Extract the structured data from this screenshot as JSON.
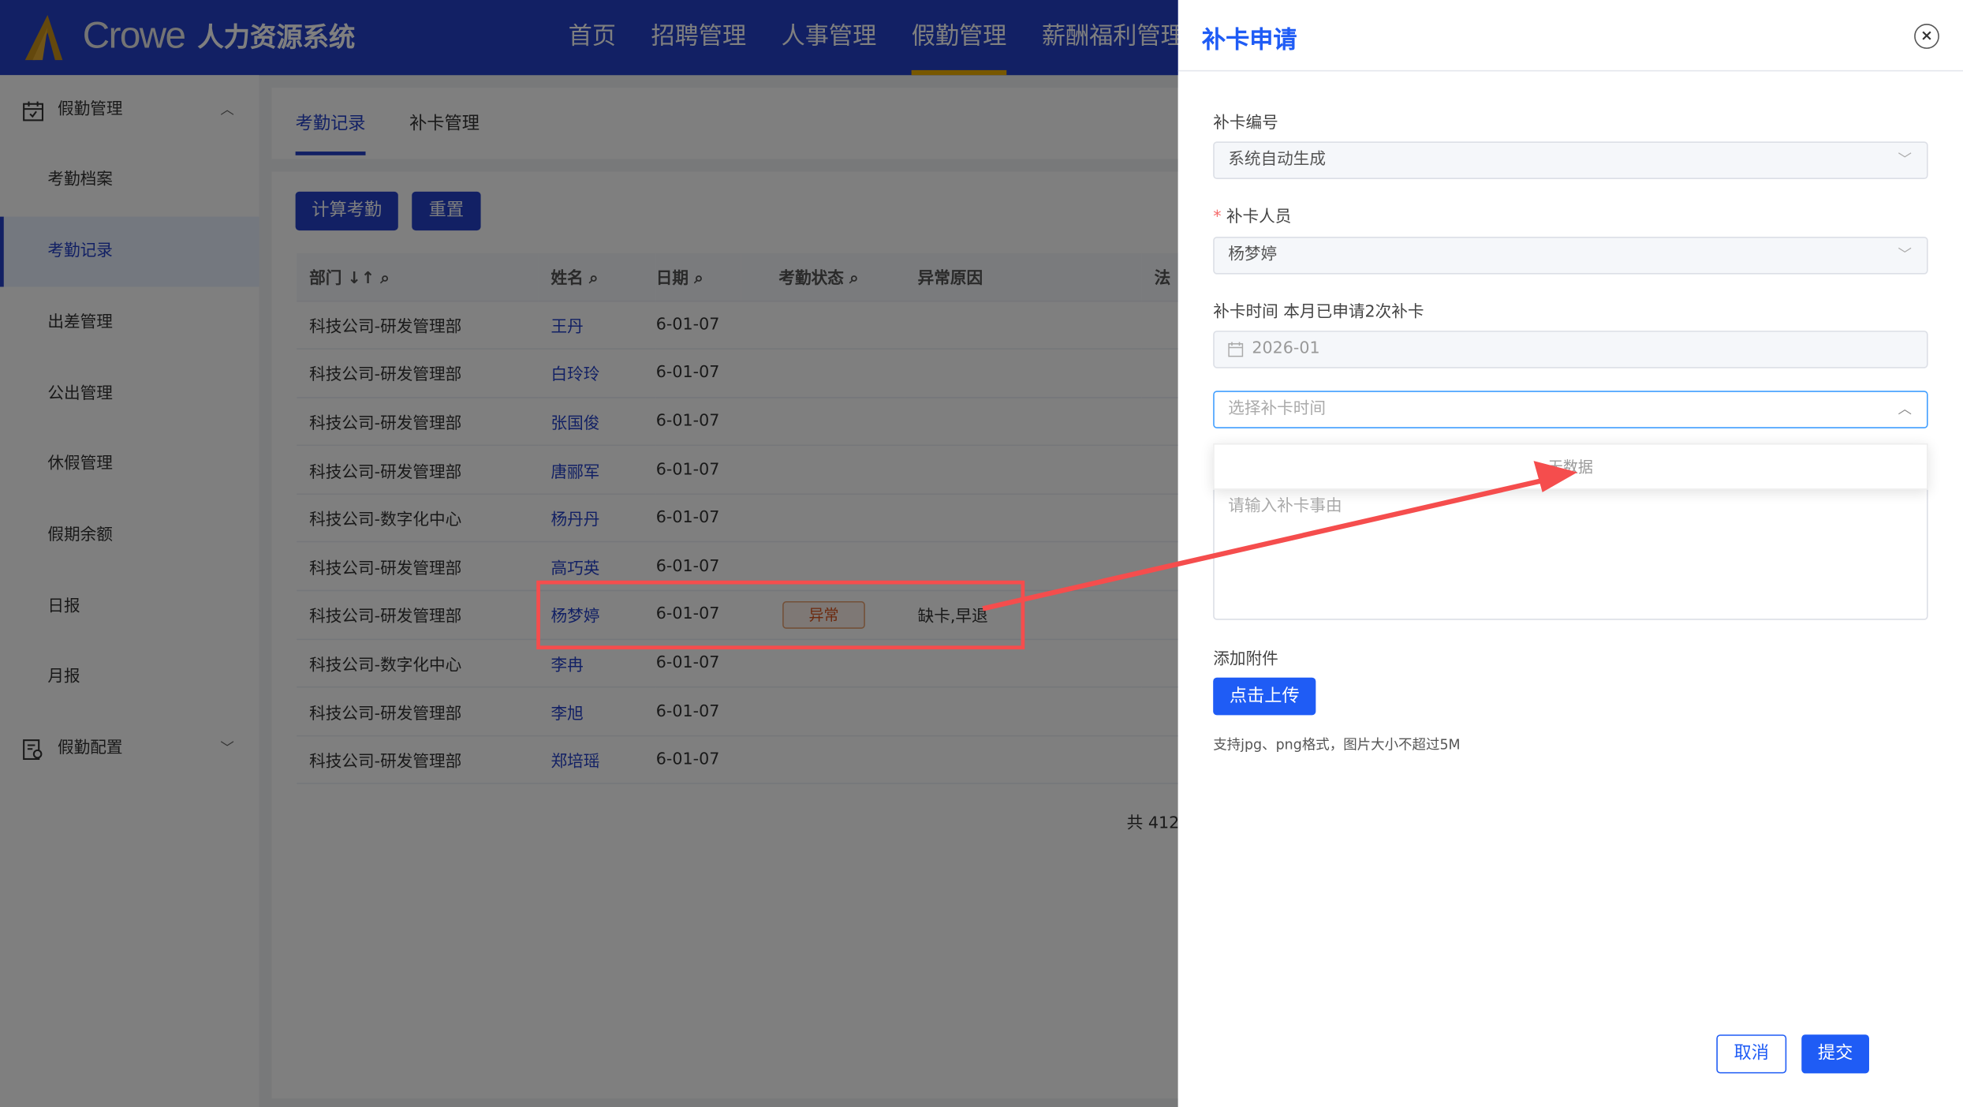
{
  "header": {
    "brand": "Crowe",
    "system": "人力资源系统",
    "nav": [
      "首页",
      "招聘管理",
      "人事管理",
      "假勤管理",
      "薪酬福利管理"
    ],
    "active_nav": 3
  },
  "sidebar": {
    "group1": "假勤管理",
    "items": [
      "考勤档案",
      "考勤记录",
      "出差管理",
      "公出管理",
      "休假管理",
      "假期余额",
      "日报",
      "月报"
    ],
    "active": 1,
    "group2": "假勤配置"
  },
  "tabs": [
    "考勤记录",
    "补卡管理"
  ],
  "toolbar": {
    "calc": "计算考勤",
    "reset": "重置"
  },
  "table": {
    "headers": [
      "部门 ↓↑",
      "姓名",
      "日期",
      "考勤状态",
      "异常原因",
      "法"
    ],
    "rows": [
      [
        "科技公司-研发管理部",
        "王丹",
        "6-01-07",
        "",
        ""
      ],
      [
        "科技公司-研发管理部",
        "白玲玲",
        "6-01-07",
        "",
        ""
      ],
      [
        "科技公司-研发管理部",
        "张国俊",
        "6-01-07",
        "",
        ""
      ],
      [
        "科技公司-研发管理部",
        "唐郦军",
        "6-01-07",
        "",
        ""
      ],
      [
        "科技公司-数字化中心",
        "杨丹丹",
        "6-01-07",
        "",
        ""
      ],
      [
        "科技公司-研发管理部",
        "高巧英",
        "6-01-07",
        "",
        ""
      ],
      [
        "科技公司-研发管理部",
        "杨梦婷",
        "6-01-07",
        "异常",
        "缺卡,早退"
      ],
      [
        "科技公司-数字化中心",
        "李冉",
        "6-01-07",
        "",
        ""
      ],
      [
        "科技公司-研发管理部",
        "李旭",
        "6-01-07",
        "",
        ""
      ],
      [
        "科技公司-研发管理部",
        "郑培瑶",
        "6-01-07",
        "",
        ""
      ]
    ],
    "total": "共 412"
  },
  "drawer": {
    "title": "补卡申请",
    "close": "×",
    "f1_label": "补卡编号",
    "f1_value": "系统自动生成",
    "f2_label": "补卡人员",
    "f2_value": "杨梦婷",
    "f3_label": "补卡时间 本月已申请2次补卡",
    "month": "2026-01",
    "time_placeholder": "选择补卡时间",
    "no_data": "无数据",
    "reason_placeholder": "请输入补卡事由",
    "attach_label": "添加附件",
    "upload": "点击上传",
    "hint": "支持jpg、png格式，图片大小不超过5M",
    "cancel": "取消",
    "submit": "提交"
  },
  "colors": {
    "primary": "#1f5cf5",
    "annotation": "#f54d4d"
  }
}
